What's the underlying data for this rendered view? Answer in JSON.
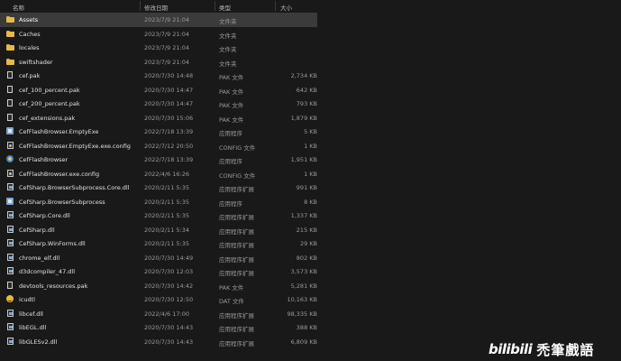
{
  "header": {
    "name": "名称",
    "date": "修改日期",
    "type": "类型",
    "size": "大小"
  },
  "files": [
    {
      "icon": "folder-icon",
      "name": "Assets",
      "date": "2023/7/9 21:04",
      "type": "文件夹",
      "size": "",
      "selected": true
    },
    {
      "icon": "folder-icon",
      "name": "Caches",
      "date": "2023/7/9 21:04",
      "type": "文件夹",
      "size": ""
    },
    {
      "icon": "folder-icon",
      "name": "locales",
      "date": "2023/7/9 21:04",
      "type": "文件夹",
      "size": ""
    },
    {
      "icon": "folder-icon",
      "name": "swiftshader",
      "date": "2023/7/9 21:04",
      "type": "文件夹",
      "size": ""
    },
    {
      "icon": "file-icon",
      "name": "cef.pak",
      "date": "2020/7/30 14:48",
      "type": "PAK 文件",
      "size": "2,734 KB"
    },
    {
      "icon": "file-icon",
      "name": "cef_100_percent.pak",
      "date": "2020/7/30 14:47",
      "type": "PAK 文件",
      "size": "642 KB"
    },
    {
      "icon": "file-icon",
      "name": "cef_200_percent.pak",
      "date": "2020/7/30 14:47",
      "type": "PAK 文件",
      "size": "793 KB"
    },
    {
      "icon": "file-icon",
      "name": "cef_extensions.pak",
      "date": "2020/7/30 15:06",
      "type": "PAK 文件",
      "size": "1,879 KB"
    },
    {
      "icon": "exe-icon",
      "name": "CefFlashBrowser.EmptyExe",
      "date": "2022/7/18 13:39",
      "type": "应用程序",
      "size": "5 KB"
    },
    {
      "icon": "cfg-icon",
      "name": "CefFlashBrowser.EmptyExe.exe.config",
      "date": "2022/7/12 20:50",
      "type": "CONFIG 文件",
      "size": "1 KB"
    },
    {
      "icon": "app-icon",
      "name": "CefFlashBrowser",
      "date": "2022/7/18 13:39",
      "type": "应用程序",
      "size": "1,951 KB"
    },
    {
      "icon": "cfg-icon",
      "name": "CefFlashBrowser.exe.config",
      "date": "2022/4/6 16:26",
      "type": "CONFIG 文件",
      "size": "1 KB"
    },
    {
      "icon": "dll-icon",
      "name": "CefSharp.BrowserSubprocess.Core.dll",
      "date": "2020/2/11 5:35",
      "type": "应用程序扩展",
      "size": "991 KB"
    },
    {
      "icon": "exe-icon",
      "name": "CefSharp.BrowserSubprocess",
      "date": "2020/2/11 5:35",
      "type": "应用程序",
      "size": "8 KB"
    },
    {
      "icon": "dll-icon",
      "name": "CefSharp.Core.dll",
      "date": "2020/2/11 5:35",
      "type": "应用程序扩展",
      "size": "1,337 KB"
    },
    {
      "icon": "dll-icon",
      "name": "CefSharp.dll",
      "date": "2020/2/11 5:34",
      "type": "应用程序扩展",
      "size": "215 KB"
    },
    {
      "icon": "dll-icon",
      "name": "CefSharp.WinForms.dll",
      "date": "2020/2/11 5:35",
      "type": "应用程序扩展",
      "size": "29 KB"
    },
    {
      "icon": "dll-icon",
      "name": "chrome_elf.dll",
      "date": "2020/7/30 14:49",
      "type": "应用程序扩展",
      "size": "802 KB"
    },
    {
      "icon": "dll-icon",
      "name": "d3dcompiler_47.dll",
      "date": "2020/7/30 12:03",
      "type": "应用程序扩展",
      "size": "3,573 KB"
    },
    {
      "icon": "file-icon",
      "name": "devtools_resources.pak",
      "date": "2020/7/30 14:42",
      "type": "PAK 文件",
      "size": "5,281 KB"
    },
    {
      "icon": "smiley-icon",
      "name": "icudtl",
      "date": "2020/7/30 12:50",
      "type": "DAT 文件",
      "size": "10,163 KB"
    },
    {
      "icon": "dll-icon",
      "name": "libcef.dll",
      "date": "2022/4/6 17:00",
      "type": "应用程序扩展",
      "size": "98,335 KB"
    },
    {
      "icon": "dll-icon",
      "name": "libEGL.dll",
      "date": "2020/7/30 14:43",
      "type": "应用程序扩展",
      "size": "388 KB"
    },
    {
      "icon": "dll-icon",
      "name": "libGLESv2.dll",
      "date": "2020/7/30 14:43",
      "type": "应用程序扩展",
      "size": "6,809 KB"
    }
  ],
  "watermark": {
    "logo": "bilibili",
    "text": "禿筆戲語"
  },
  "colors": {
    "background": "#191919",
    "selected_row": "#3b3b3b",
    "folder": "#e8b84a"
  }
}
